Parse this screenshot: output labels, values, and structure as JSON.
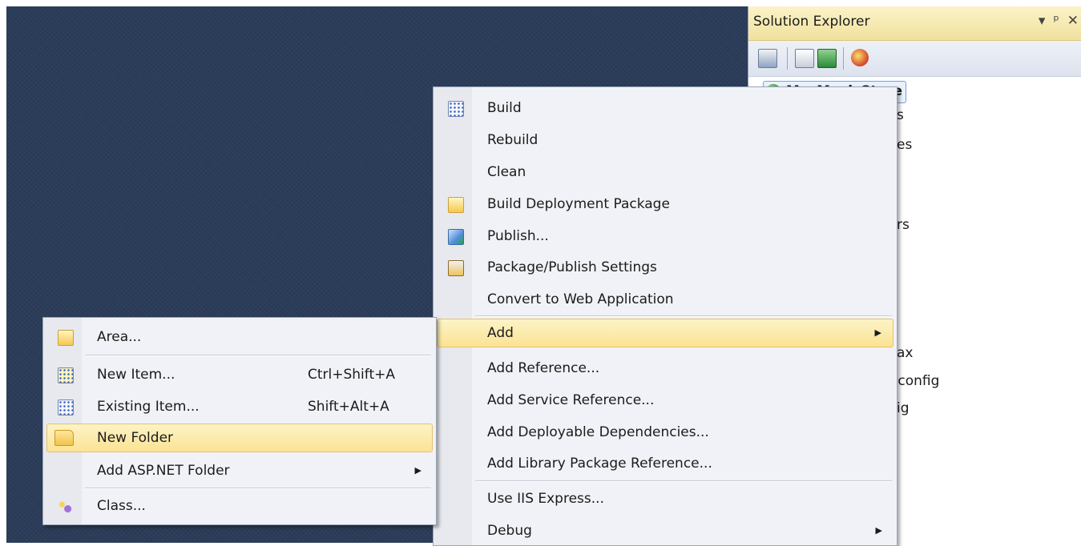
{
  "solution_explorer": {
    "title": "Solution Explorer",
    "title_buttons": [
      "▾",
      "ᵖ",
      "✕"
    ],
    "toolbar_icons": [
      "properties-icon",
      "show-all-files-icon",
      "refresh-icon",
      "copy-web-site-icon"
    ],
    "project_name": "MvcMusicStore",
    "tree_fragments": [
      "s",
      "es",
      "rs",
      "ax",
      ".config",
      "ig"
    ]
  },
  "context_menu": {
    "items": [
      {
        "label": "Build",
        "icon": "build-icon"
      },
      {
        "label": "Rebuild",
        "icon": ""
      },
      {
        "label": "Clean",
        "icon": ""
      },
      {
        "label": "Build Deployment Package",
        "icon": "package-icon"
      },
      {
        "label": "Publish...",
        "icon": "publish-icon"
      },
      {
        "label": "Package/Publish Settings",
        "icon": "settings-icon"
      },
      {
        "label": "Convert to Web Application",
        "icon": ""
      },
      {
        "label": "Add",
        "icon": "",
        "submenu": true,
        "highlighted": true
      },
      {
        "label": "Add Reference...",
        "icon": ""
      },
      {
        "label": "Add Service Reference...",
        "icon": ""
      },
      {
        "label": "Add Deployable Dependencies...",
        "icon": ""
      },
      {
        "label": "Add Library Package Reference...",
        "icon": ""
      },
      {
        "label": "Use IIS Express...",
        "icon": ""
      },
      {
        "label": "Debug",
        "icon": "",
        "submenu": true
      }
    ]
  },
  "add_submenu": {
    "items": [
      {
        "label": "Area...",
        "shortcut": "",
        "icon": "area-icon"
      },
      {
        "label": "New Item...",
        "shortcut": "Ctrl+Shift+A",
        "icon": "new-item-icon"
      },
      {
        "label": "Existing Item...",
        "shortcut": "Shift+Alt+A",
        "icon": "existing-item-icon"
      },
      {
        "label": "New Folder",
        "shortcut": "",
        "icon": "new-folder-icon",
        "highlighted": true
      },
      {
        "label": "Add ASP.NET Folder",
        "shortcut": "",
        "icon": "",
        "submenu": true
      },
      {
        "label": "Class...",
        "shortcut": "",
        "icon": "class-icon"
      }
    ]
  }
}
